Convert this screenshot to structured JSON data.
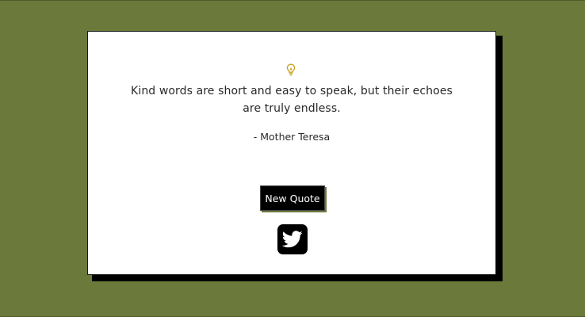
{
  "quote": {
    "icon": "lightbulb-icon",
    "text": "Kind words are short and easy to speak, but their echoes are truly endless.",
    "author": "- Mother Teresa"
  },
  "actions": {
    "new_quote_label": "New Quote",
    "tweet_icon": "twitter-icon"
  },
  "colors": {
    "background": "#6b7a3a",
    "card": "#ffffff",
    "card_shadow": "#000000",
    "button": "#000000",
    "button_text": "#ffffff",
    "bulb": "#c9a227"
  }
}
